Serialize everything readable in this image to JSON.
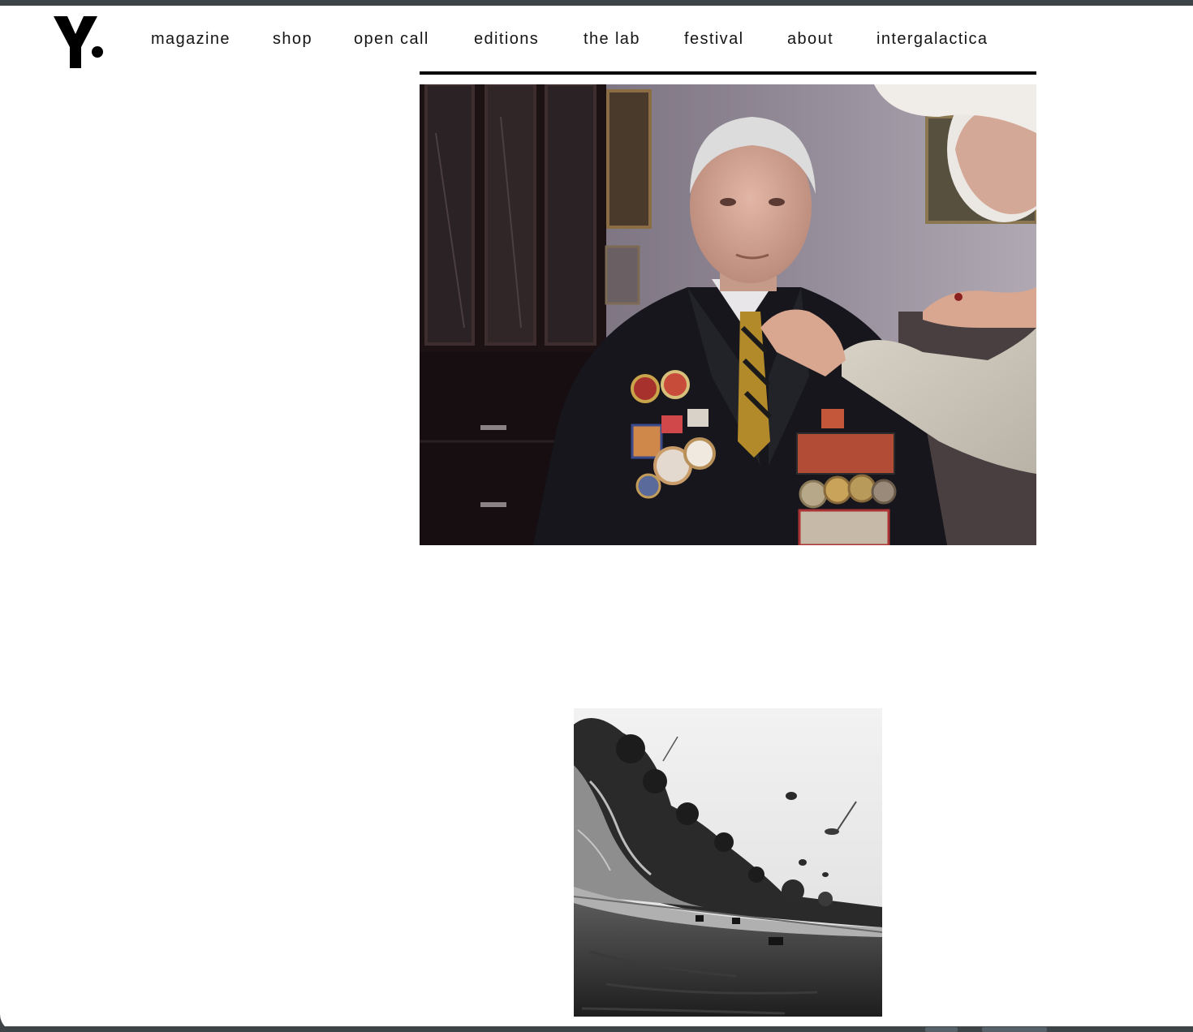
{
  "site": {
    "logo_icon": "y-dot-logo-icon",
    "brand_color": "#000000"
  },
  "nav": {
    "items": [
      {
        "label": "magazine"
      },
      {
        "label": "shop"
      },
      {
        "label": "open call"
      },
      {
        "label": "editions"
      },
      {
        "label": "the lab"
      },
      {
        "label": "festival"
      },
      {
        "label": "about"
      },
      {
        "label": "intergalactica"
      }
    ]
  },
  "content": {
    "images": [
      {
        "name": "photo-veteran-with-medals"
      },
      {
        "name": "photo-landscape-black-white"
      }
    ]
  },
  "colors": {
    "window_chrome": "#3d4447",
    "page_background": "#ffffff",
    "text": "#151515"
  }
}
